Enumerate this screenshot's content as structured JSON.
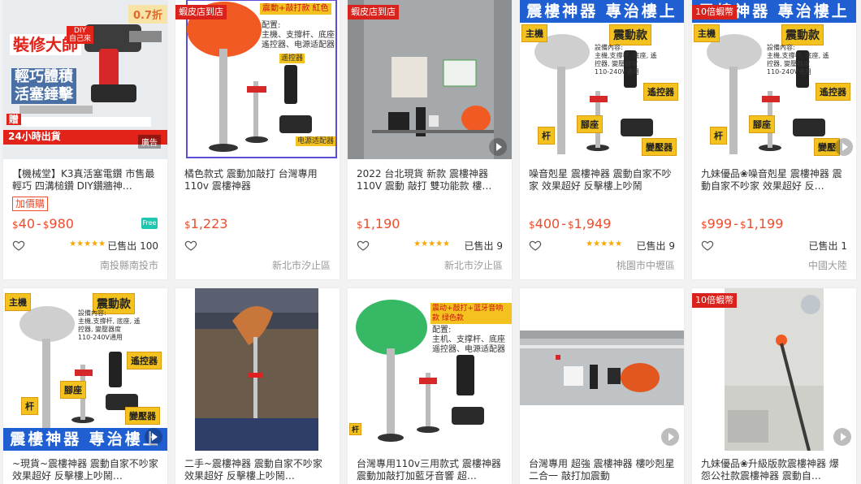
{
  "colors": {
    "price": "#ee4d2d",
    "tag": "#d8221b",
    "star": "#f6a700",
    "banner": "#1f5fd1",
    "yellow": "#f3c21f"
  },
  "icons": {
    "heart": "heart-outline-icon",
    "video": "play-video-icon",
    "free_shipping": "free-shipping-icon",
    "star": "star-icon"
  },
  "products": [
    {
      "title": "【機械堂】K3真活塞電鑽 市售最輕巧 四溝槌鑽 DIY鑽牆神…",
      "addon_label": "加價購",
      "price_min": "40",
      "price_max": "980",
      "rating_stars": 5,
      "sold": "已售出 100",
      "location": "南投縣南投市",
      "image": {
        "discount": "0.7折",
        "headline": "裝修大師",
        "sub1": "輕巧體積",
        "sub2": "活塞錘擊",
        "diy_badge": "DIY\n自己來",
        "gift": "贈",
        "bottom_strip": "24小時出貨",
        "ad_label": "廣告"
      }
    },
    {
      "title": "橘色款式 震動加敲打 台灣專用110v 震樓神器",
      "price": "1,223",
      "location": "新北市汐止區",
      "image": {
        "shop_tag": "蝦皮店到店",
        "box_header": "震動+敲打款 紅色",
        "box_text": "配置:\n主機、支撐杆、底座\n遙控器、电源适配器",
        "remote_label": "遥控器",
        "adapter_label": "电源适配器"
      }
    },
    {
      "title": "2022 台北現貨 新款 震樓神器 110V 震動 敲打 雙功能款 樓…",
      "price": "1,190",
      "rating_stars": 5,
      "sold": "已售出 9",
      "location": "新北市汐止區",
      "image": {
        "shop_tag": "蝦皮店到店"
      }
    },
    {
      "title": "噪音剋星 震樓神器 震動自家不吵家 效果超好 反擊樓上吵鬧",
      "price_min": "400",
      "price_max": "1,949",
      "rating_stars": 5,
      "sold": "已售出 9",
      "location": "桃園市中壢區",
      "image": {
        "banner": "震樓神器 專治樓上",
        "host_label": "主機",
        "mode_label": "震動款",
        "spec_text": "設備內容:\n主機,支撐杆, 底座, 遙\n控器, 變壓器度\n110-240V通用",
        "remote_label": "遙控器",
        "base_label": "腳座",
        "rod_label": "杆",
        "adapter_label": "變壓器"
      }
    },
    {
      "title": "九妹優品❀噪音剋星 震樓神器 震動自家不吵家 效果超好 反…",
      "price_min": "999",
      "price_max": "1,199",
      "sold": "已售出 1",
      "location": "中國大陸",
      "image": {
        "tag": "10倍蝦幣",
        "banner": "震樓神器 專治樓上",
        "host_label": "主機",
        "mode_label": "震動款",
        "spec_text": "設備內容:\n主機,支撐杆, 底座, 遙\n控器, 變壓器度\n110-240V通用",
        "remote_label": "遙控器",
        "base_label": "腳座",
        "rod_label": "杆",
        "adapter_label": "變壓"
      }
    },
    {
      "title": "~現貨~震樓神器 震動自家不吵家 效果超好 反擊樓上吵鬧…",
      "image": {
        "banner": "震樓神器 專治樓上",
        "host_label": "主機",
        "mode_label": "震動款",
        "spec_text": "設備內容:\n主機,支撐杆, 底座, 遙\n控器, 變壓器度\n110-240V通用",
        "remote_label": "遙控器",
        "base_label": "腳座",
        "rod_label": "杆",
        "adapter_label": "變壓器"
      }
    },
    {
      "title": "二手~震樓神器 震動自家不吵家 效果超好 反擊樓上吵鬧…"
    },
    {
      "title": "台灣專用110v三用款式 震樓神器 震動加敲打加藍牙音響 超…",
      "image": {
        "box_header": "震动+敲打+蓝牙音响款 绿色款",
        "box_text": "配置:\n主机、支撑杆、底座\n遥控器、电源适配器",
        "label_rod": "杆"
      }
    },
    {
      "title": "台灣專用 超強 震樓神器 樓吵剋星 二合一 敲打加震動"
    },
    {
      "title": "九妹優品❀升級版款震樓神器 爆怨公社款震樓神器 震動自…",
      "image": {
        "tag": "10倍蝦幣"
      }
    }
  ]
}
